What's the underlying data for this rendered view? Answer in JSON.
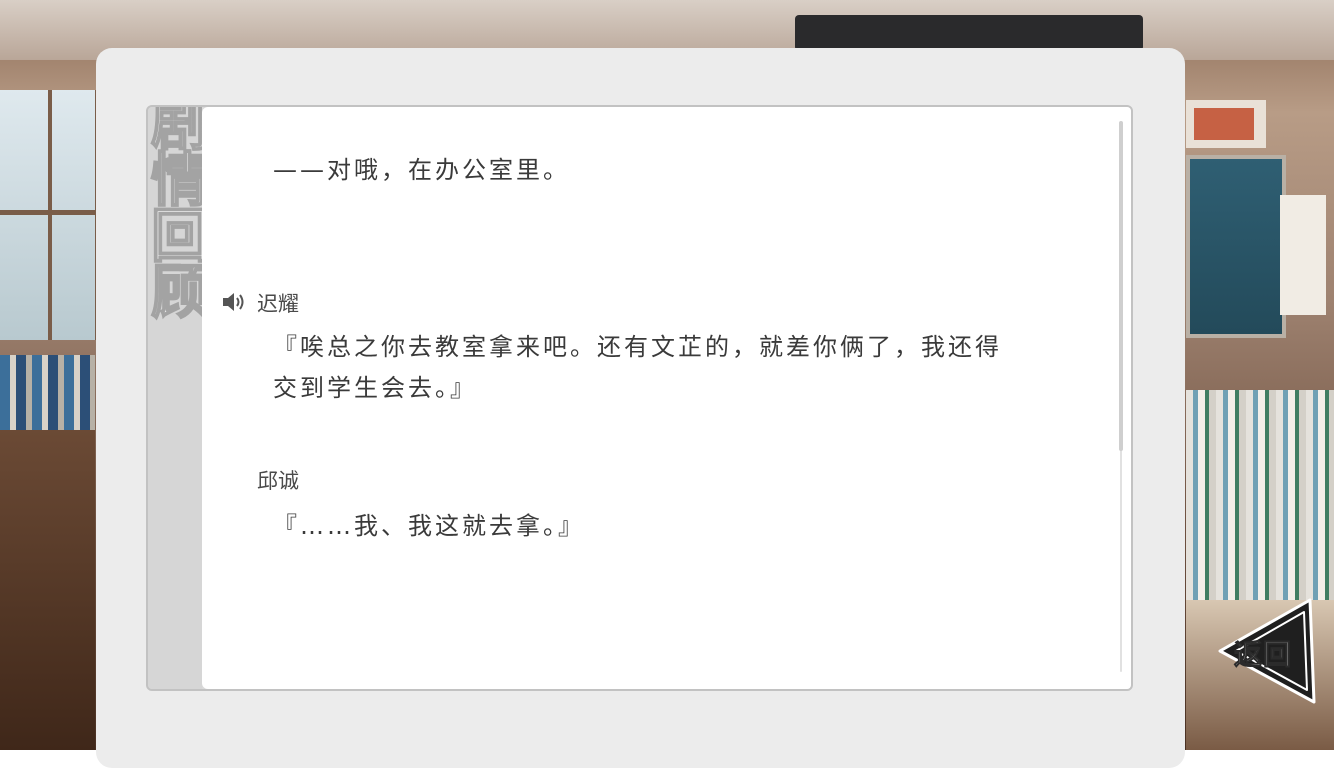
{
  "panel_title": "剧情回顾",
  "entries": [
    {
      "speaker": "",
      "has_voice": false,
      "lines": [
        "——对哦，在办公室里。"
      ]
    },
    {
      "speaker": "迟耀",
      "has_voice": true,
      "lines": [
        "『唉总之你去教室拿来吧。还有文芷的，就差你俩了，我还得",
        "交到学生会去。』"
      ]
    },
    {
      "speaker": "邱诚",
      "has_voice": false,
      "lines": [
        "『……我、我这就去拿。』"
      ]
    }
  ],
  "back_button": {
    "label": "返回"
  },
  "scrollbar": {
    "position_fraction": 0
  },
  "icons": {
    "voice": "speaker-icon",
    "back": "back-arrow-icon"
  }
}
